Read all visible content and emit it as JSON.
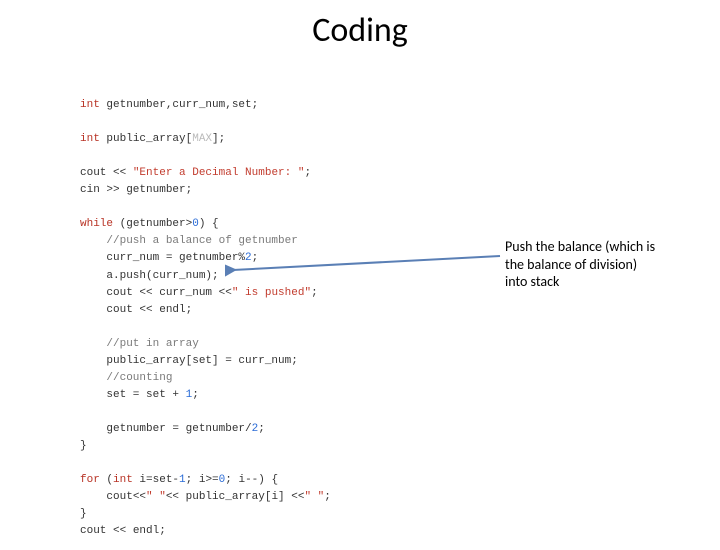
{
  "title": "Coding",
  "code": {
    "l1_kw": "int",
    "l1_rest": " getnumber,curr_num,set;",
    "l2_kw": "int",
    "l2_a": " public_array[",
    "l2_max": "MAX",
    "l2_b": "];",
    "l3_a": "cout ",
    "l3_op1": "<<",
    "l3_str": " \"Enter a Decimal Number: \"",
    "l3_b": ";",
    "l4_a": "cin ",
    "l4_op1": ">>",
    "l4_b": " getnumber;",
    "l5_kw": "while",
    "l5_a": " (getnumber>",
    "l5_zero": "0",
    "l5_b": ") {",
    "l6_com": "    //push a balance of getnumber",
    "l7_a": "    curr_num = getnumber%",
    "l7_two": "2",
    "l7_b": ";",
    "l8": "    a.push(curr_num);",
    "l9_a": "    cout ",
    "l9_op1": "<<",
    "l9_b": " curr_num ",
    "l9_op2": "<<",
    "l9_str": "\" is pushed\"",
    "l9_c": ";",
    "l10_a": "    cout ",
    "l10_op1": "<<",
    "l10_b": " endl;",
    "l11_com": "    //put in array",
    "l12": "    public_array[set] = curr_num;",
    "l13_com": "    //counting",
    "l14_a": "    set = set + ",
    "l14_one": "1",
    "l14_b": ";",
    "l15_a": "    getnumber = getnumber/",
    "l15_two": "2",
    "l15_b": ";",
    "l16": "}",
    "l17_kw": "for",
    "l17_a": " (",
    "l17_kw2": "int",
    "l17_b": " i=set-",
    "l17_one": "1",
    "l17_c": "; i>=",
    "l17_zero": "0",
    "l17_d": "; i--) {",
    "l18_a": "    cout",
    "l18_op1": "<<",
    "l18_str1": "\" \"",
    "l18_op2": "<<",
    "l18_b": " public_array[i] ",
    "l18_op3": "<<",
    "l18_str2": "\" \"",
    "l18_c": ";",
    "l19": "}",
    "l20_a": "cout ",
    "l20_op1": "<<",
    "l20_b": " endl;"
  },
  "annotation": {
    "line1": "Push the balance (which is",
    "line2": "the balance of division)",
    "line3": "into stack"
  }
}
